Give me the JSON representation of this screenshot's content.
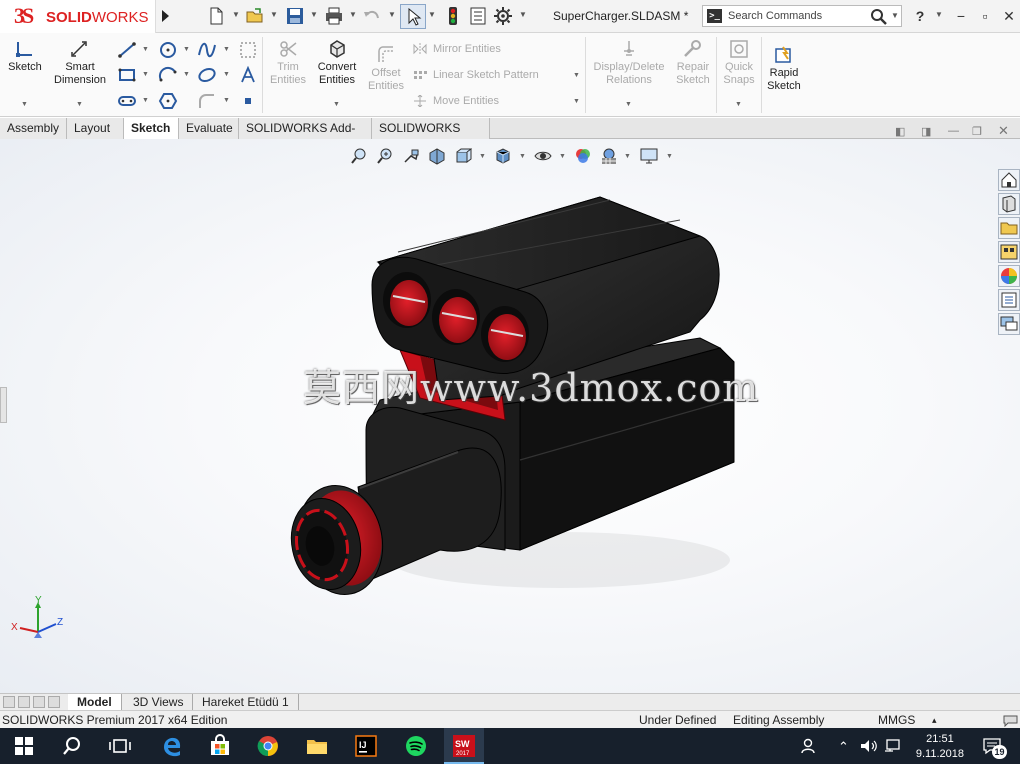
{
  "app": {
    "logo_mark": "3S",
    "logo_bold": "SOLID",
    "logo_rest": "WORKS",
    "document_title": "SuperCharger.SLDASM *",
    "search_placeholder": "Search Commands",
    "help_label": "?",
    "window_min": "−",
    "window_restore": "▫",
    "window_close": "✕"
  },
  "ribbon": {
    "sketch": "Sketch",
    "smart_dimension_1": "Smart",
    "smart_dimension_2": "Dimension",
    "trim_1": "Trim",
    "trim_2": "Entities",
    "convert_1": "Convert",
    "convert_2": "Entities",
    "offset_1": "Offset",
    "offset_2": "Entities",
    "mirror": "Mirror Entities",
    "linear_pattern": "Linear Sketch Pattern",
    "move": "Move Entities",
    "relations_1": "Display/Delete",
    "relations_2": "Relations",
    "repair_1": "Repair",
    "repair_2": "Sketch",
    "snaps_1": "Quick",
    "snaps_2": "Snaps",
    "rapid_1": "Rapid",
    "rapid_2": "Sketch"
  },
  "tabs": [
    "Assembly",
    "Layout",
    "Sketch",
    "Evaluate",
    "SOLIDWORKS Add-Ins",
    "SOLIDWORKS MBD"
  ],
  "active_tab": "Sketch",
  "viewport": {
    "watermark": "莫西网www.3dmox.com",
    "triad_x": "X",
    "triad_y": "Y",
    "triad_z": "Z"
  },
  "bottom_tabs": [
    "Model",
    "3D Views",
    "Hareket Etüdü 1"
  ],
  "status": {
    "edition": "SOLIDWORKS Premium 2017 x64 Edition",
    "definition": "Under Defined",
    "mode": "Editing Assembly",
    "units": "MMGS",
    "units_caret": "▴"
  },
  "taskbar": {
    "time": "21:51",
    "date": "9.11.2018",
    "notifications": "19",
    "sw_badge": "SW",
    "sw_year": "2017"
  },
  "colors": {
    "brand_red": "#d22222",
    "model_body": "#1c1c1c",
    "model_accent": "#d0141c",
    "taskbar": "#17202c"
  }
}
